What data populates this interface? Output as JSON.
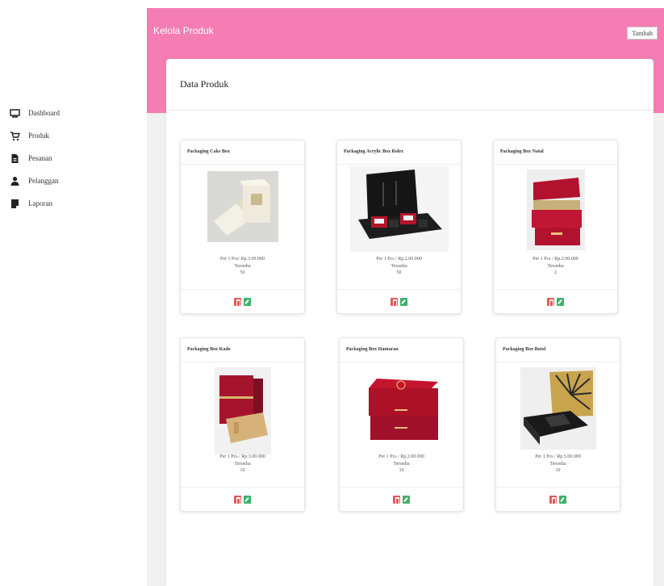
{
  "sidebar": {
    "items": [
      {
        "label": "Dashboard",
        "icon": "monitor-icon"
      },
      {
        "label": "Produk",
        "icon": "cart-icon"
      },
      {
        "label": "Pesanan",
        "icon": "file-icon"
      },
      {
        "label": "Pelanggan",
        "icon": "user-icon"
      },
      {
        "label": "Laporan",
        "icon": "report-icon"
      }
    ]
  },
  "header": {
    "title": "Kelola Produk",
    "add_label": "Tambah",
    "accent_color": "#f47db3"
  },
  "panel": {
    "title": "Data Produk"
  },
  "products": [
    {
      "name": "Packaging Cake Box",
      "price": "Per 1 Pcs/ Rp.3.00.000",
      "stock_label": "Tersedia",
      "stock": "50"
    },
    {
      "name": "Packaging Acrylic Box Rolex",
      "price": "Per 1 Pcs / Rp.2.00.000",
      "stock_label": "Tersedia",
      "stock": "50"
    },
    {
      "name": "Packaging Box Natal",
      "price": "Per 1 Pcs / Rp.2.00.000",
      "stock_label": "Tersedia",
      "stock": "2"
    },
    {
      "name": "Packaging Box Kado",
      "price": "Per 1 Pcs / Rp.3.00.000",
      "stock_label": "Tersedia",
      "stock": "10"
    },
    {
      "name": "Packaging  Box  Hantaran",
      "price": "Per 1 Pcs / Rp.2.00.000",
      "stock_label": "Tersedia",
      "stock": "10"
    },
    {
      "name": "Packaging Box Botol",
      "price": "Per 1 Pcs / Rp.5.00.000",
      "stock_label": "Tersedia",
      "stock": "10"
    }
  ]
}
